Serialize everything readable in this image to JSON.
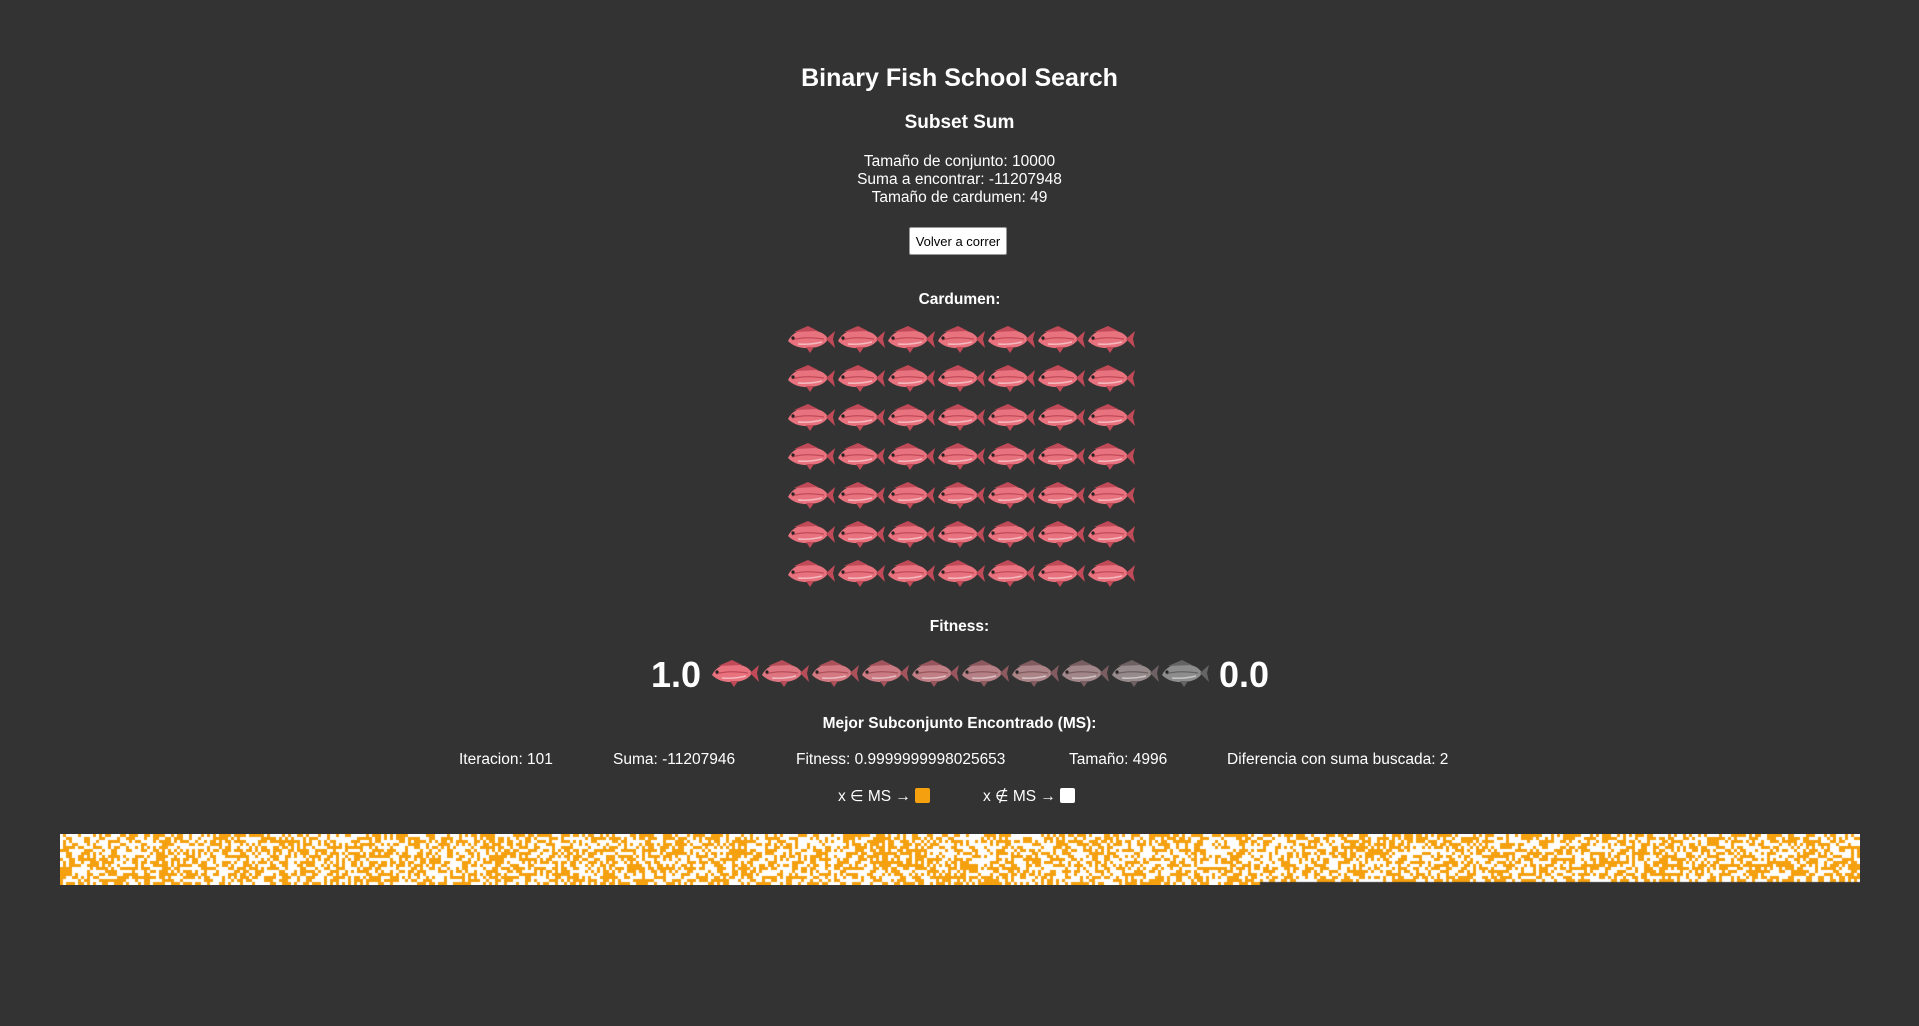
{
  "title": "Binary Fish School Search",
  "subtitle": "Subset Sum",
  "info": {
    "set_size": "Tamaño de conjunto: 10000",
    "target_sum": "Suma a encontrar: -11207948",
    "school_size": "Tamaño de cardumen: 49"
  },
  "run_button": "Volver a correr",
  "school_label": "Cardumen:",
  "school": {
    "count": 49,
    "icon": "red-fish-icon"
  },
  "fitness_label": "Fitness:",
  "fitness_scale": {
    "high": "1.0",
    "low": "0.0",
    "steps": 10
  },
  "best_label": "Mejor Subconjunto Encontrado (MS):",
  "stats": {
    "iteration": "Iteracion: 101",
    "sum": "Suma: -11207946",
    "fitness": "Fitness: 0.9999999998025653",
    "size": "Tamaño: 4996",
    "difference": "Diferencia con suma buscada: 2"
  },
  "legend": {
    "in_ms": "x ∈ MS →",
    "not_in_ms": "x ∉ MS →"
  },
  "colors": {
    "background": "#333333",
    "in_ms": "#f5a00f",
    "not_in_ms": "#ffffff",
    "fish_body": "#e8737f",
    "fish_dark": "#c04a57"
  },
  "bitmap": {
    "total_elements": 10000,
    "selected": 4996
  }
}
